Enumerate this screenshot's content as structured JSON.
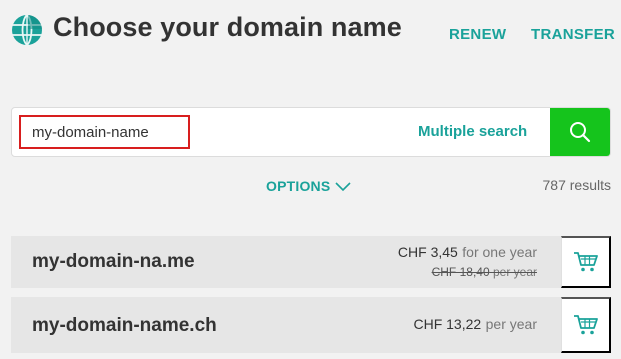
{
  "header": {
    "title": "Choose your domain name",
    "nav": [
      {
        "label": "RENEW"
      },
      {
        "label": "TRANSFER"
      }
    ]
  },
  "search": {
    "value": "my-domain-name",
    "multiple_search_label": "Multiple search",
    "icon": "search-icon"
  },
  "options": {
    "label": "OPTIONS",
    "icon": "chevron-down-icon"
  },
  "results": {
    "count_text": "787 results",
    "items": [
      {
        "domain": "my-domain-na.me",
        "price": "CHF 3,45",
        "period": "for one year",
        "old_price": "CHF 18,40",
        "old_period": "per year"
      },
      {
        "domain": "my-domain-name.ch",
        "price": "CHF 13,22",
        "period": "per year"
      }
    ]
  },
  "colors": {
    "accent": "#1aa29a",
    "search_button": "#15c41c",
    "highlight_border": "#d81e1e",
    "cart_icon": "#1aa29a"
  }
}
